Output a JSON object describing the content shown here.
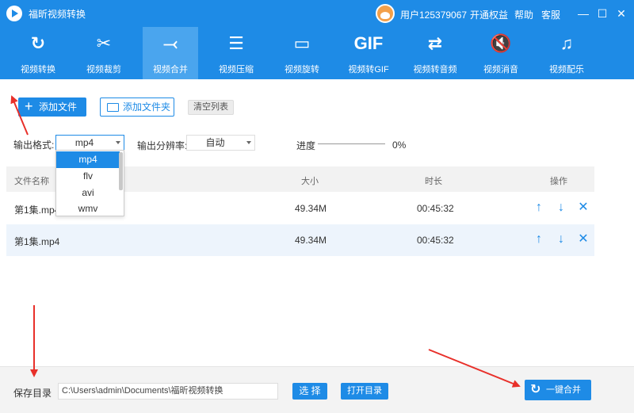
{
  "titlebar": {
    "app_title": "福昕视频转换",
    "user_name": "用户125379067",
    "links": [
      "开通权益",
      "帮助",
      "客服"
    ],
    "window_controls": [
      "—",
      "☐",
      "✕"
    ]
  },
  "toolbar": {
    "tools": [
      {
        "icon": "refresh-icon",
        "glyph": "↻",
        "label": "视频转换"
      },
      {
        "icon": "scissors-icon",
        "glyph": "✂",
        "label": "视频裁剪"
      },
      {
        "icon": "merge-icon",
        "glyph": "⤙",
        "label": "视频合并",
        "active": true
      },
      {
        "icon": "compress-icon",
        "glyph": "☰",
        "label": "视频压缩"
      },
      {
        "icon": "rotate-icon",
        "glyph": "▭",
        "label": "视频旋转"
      },
      {
        "icon": "gif-icon",
        "glyph": "GIF",
        "label": "视频转GIF"
      },
      {
        "icon": "shuffle-icon",
        "glyph": "⇄",
        "label": "视频转音频"
      },
      {
        "icon": "mute-icon",
        "glyph": "🔇",
        "label": "视频消音"
      },
      {
        "icon": "music-note-icon",
        "glyph": "♫",
        "label": "视频配乐"
      }
    ]
  },
  "actions": {
    "add_file_label": "添加文件",
    "add_folder_label": "添加文件夹",
    "clear_list_label": "清空列表"
  },
  "output": {
    "format_label": "输出格式:",
    "format_value": "mp4",
    "format_options": [
      "mp4",
      "flv",
      "avi",
      "wmv"
    ],
    "resolution_label": "输出分辨率:",
    "resolution_value": "自动",
    "progress_label": "进度",
    "progress_value": 0,
    "progress_text": "0%"
  },
  "table": {
    "headers": {
      "name": "文件名称",
      "size": "大小",
      "duration": "时长",
      "actions": "操作"
    },
    "rows": [
      {
        "name": "第1集.mp4",
        "size": "49.34M",
        "duration": "00:45:32"
      },
      {
        "name": "第1集.mp4",
        "size": "49.34M",
        "duration": "00:45:32"
      }
    ],
    "row_actions": {
      "up": "↑",
      "down": "↓",
      "remove": "✕"
    }
  },
  "footer": {
    "save_dir_label": "保存目录",
    "save_dir_path": "C:\\Users\\admin\\Documents\\福昕视频转换",
    "choose_label": "选 择",
    "open_dir_label": "打开目录",
    "merge_label": "一键合并"
  },
  "colors": {
    "accent": "#1e8be6",
    "annotation": "#e8302a"
  }
}
